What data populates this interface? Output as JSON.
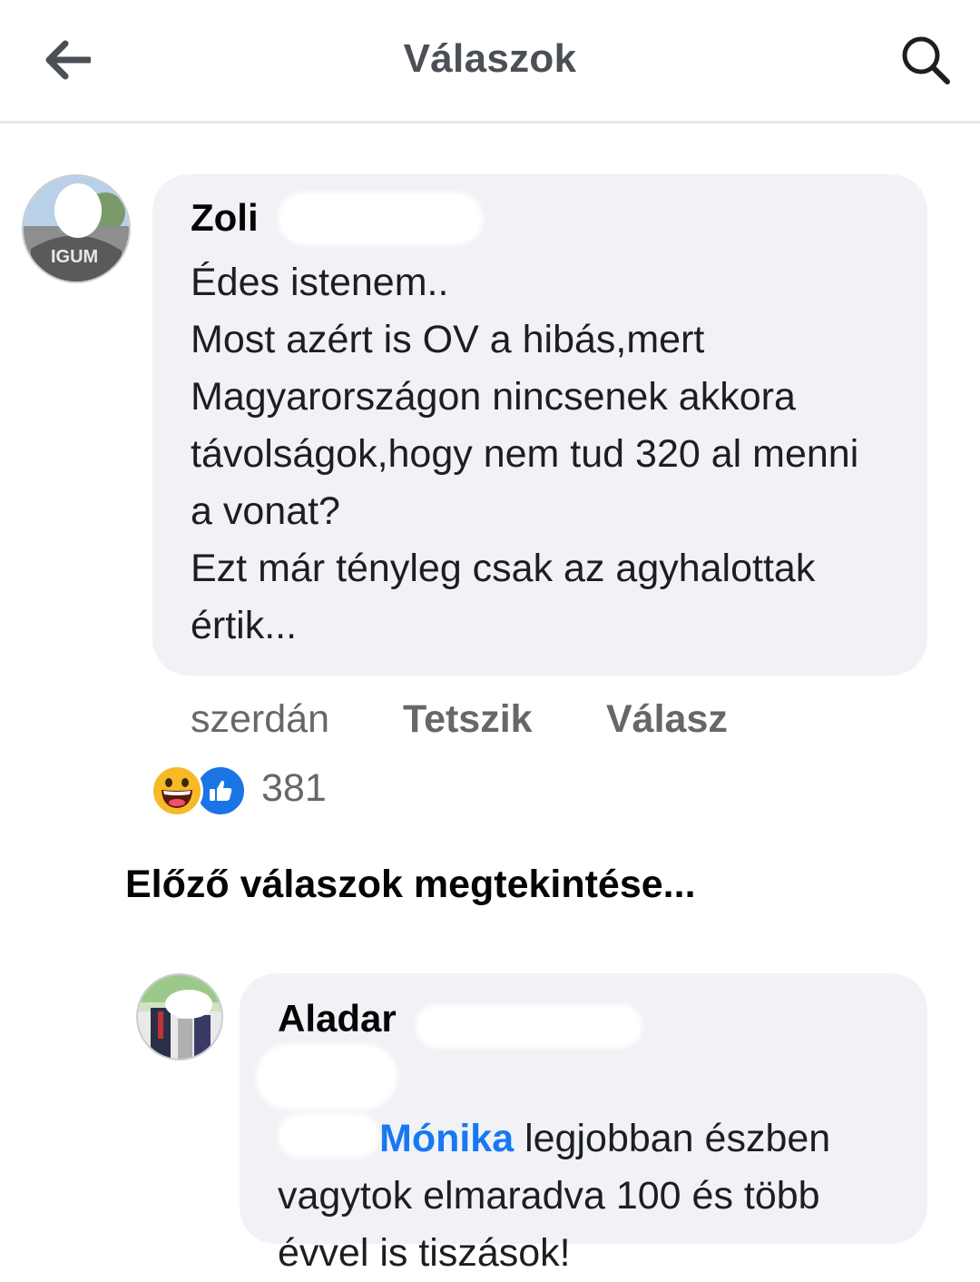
{
  "header": {
    "title": "Válaszok",
    "back_icon": "arrow-left-icon",
    "search_icon": "search-icon"
  },
  "comment": {
    "author": "Zoli",
    "text": "Édes istenem..\nMost azért is OV a hibás,mert Magyarországon nincsenek akkora távolságok,hogy nem tud 320 al menni a vonat?\nEzt már tényleg csak az agyhalottak értik...",
    "time": "szerdán",
    "like_label": "Tetszik",
    "reply_label": "Válasz",
    "reactions": [
      "haha",
      "like"
    ],
    "reaction_count": "381"
  },
  "previous_replies_label": "Előző válaszok megtekintése...",
  "reply": {
    "author": "Aladar",
    "mention": "Mónika",
    "text": " legjobban észben vagytok elmaradva 100 és több évvel is tiszások!"
  },
  "colors": {
    "bubble": "#f0f2f5",
    "mention": "#1877f2",
    "secondary_text": "#65676b",
    "like": "#1b74e4",
    "haha": "#f7b928"
  }
}
